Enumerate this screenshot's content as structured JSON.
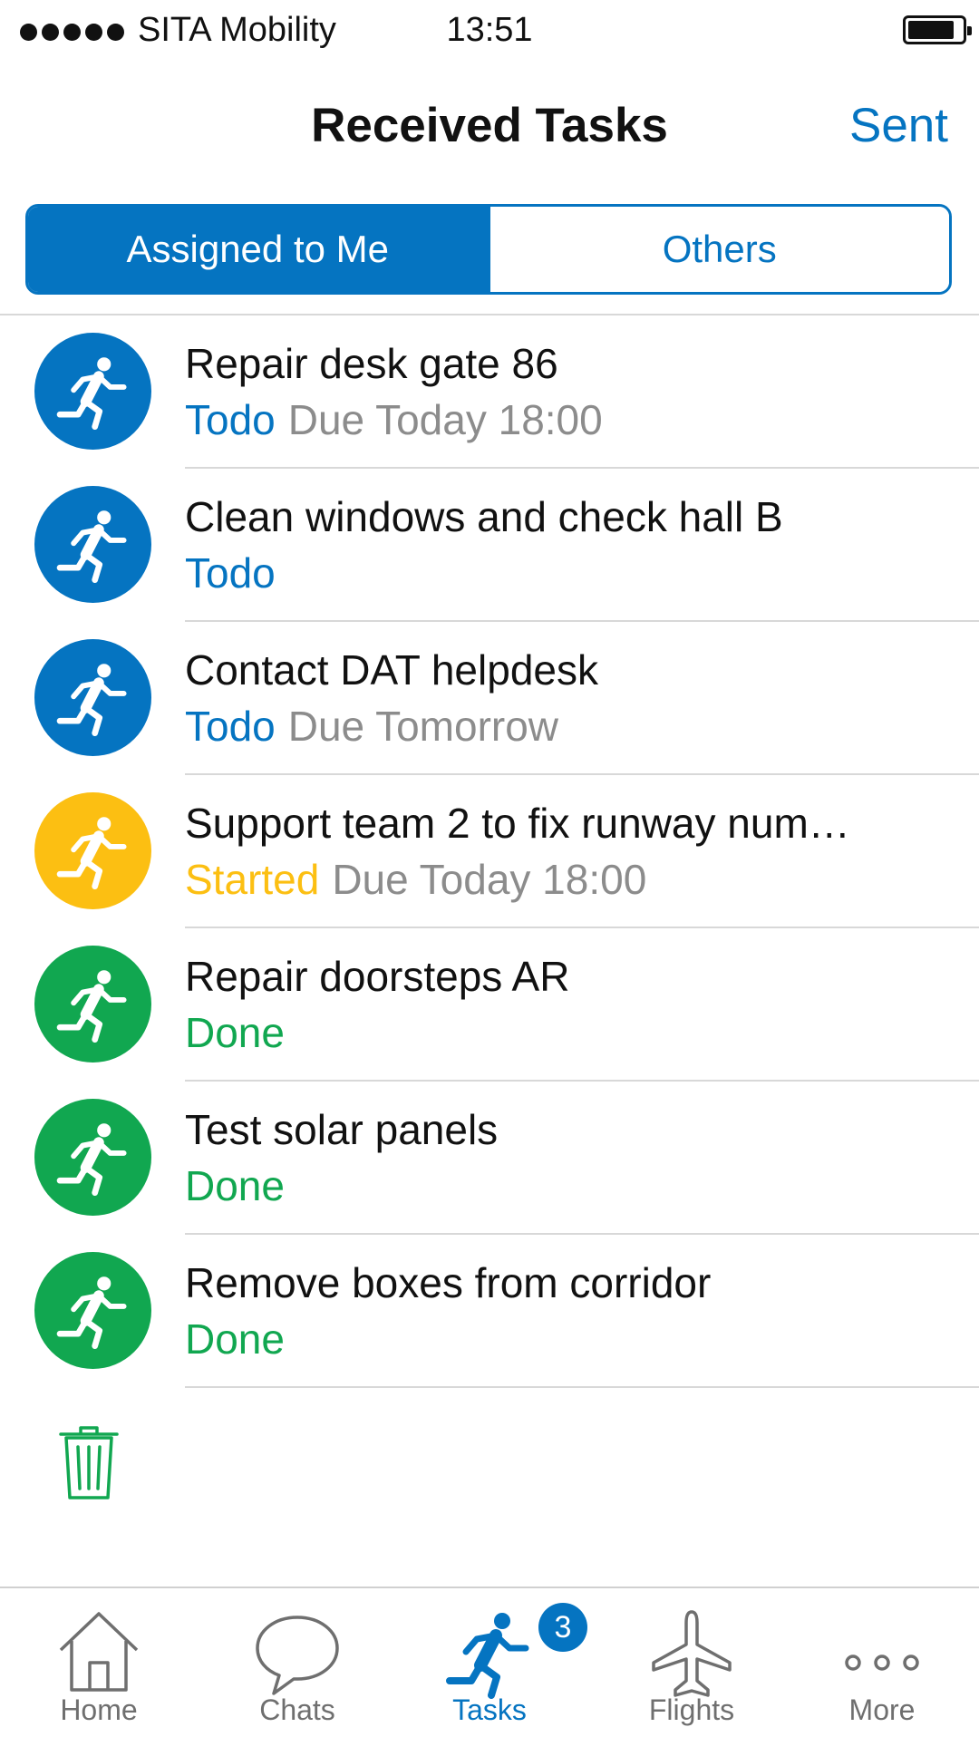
{
  "status_bar": {
    "carrier": "SITA Mobility",
    "time": "13:51",
    "signal_bars": 5,
    "battery_level": 0.8
  },
  "nav": {
    "title": "Received Tasks",
    "sent_label": "Sent"
  },
  "segments": {
    "assigned": "Assigned to Me",
    "others": "Others",
    "selected": "assigned"
  },
  "colors": {
    "accent": "#0574c1",
    "todo": "#0574c1",
    "started": "#fcbf12",
    "done": "#11a750",
    "due_text": "#8c8c8c",
    "trash": "#11a750"
  },
  "tasks": [
    {
      "title": "Repair desk gate 86",
      "status": "Todo",
      "state": "todo",
      "due": "Due Today 18:00",
      "icon": "running-person-icon"
    },
    {
      "title": "Clean windows and check hall B",
      "status": "Todo",
      "state": "todo",
      "due": "",
      "icon": "running-person-icon"
    },
    {
      "title": "Contact DAT helpdesk",
      "status": "Todo",
      "state": "todo",
      "due": "Due Tomorrow",
      "icon": "running-person-icon"
    },
    {
      "title": "Support team 2 to fix runway num…",
      "status": "Started",
      "state": "started",
      "due": "Due Today 18:00",
      "icon": "running-person-icon"
    },
    {
      "title": "Repair doorsteps AR",
      "status": "Done",
      "state": "done",
      "due": "",
      "icon": "running-person-icon"
    },
    {
      "title": "Test solar panels",
      "status": "Done",
      "state": "done",
      "due": "",
      "icon": "running-person-icon"
    },
    {
      "title": "Remove boxes from corridor",
      "status": "Done",
      "state": "done",
      "due": "",
      "icon": "running-person-icon"
    }
  ],
  "trash_icon": "trash-icon",
  "tabbar": {
    "tabs": [
      {
        "label": "Home",
        "icon": "home-icon"
      },
      {
        "label": "Chats",
        "icon": "chat-bubble-icon"
      },
      {
        "label": "Tasks",
        "icon": "running-person-icon"
      },
      {
        "label": "Flights",
        "icon": "airplane-icon"
      },
      {
        "label": "More",
        "icon": "more-dots-icon"
      }
    ],
    "active": "Tasks",
    "tasks_badge": "3"
  }
}
